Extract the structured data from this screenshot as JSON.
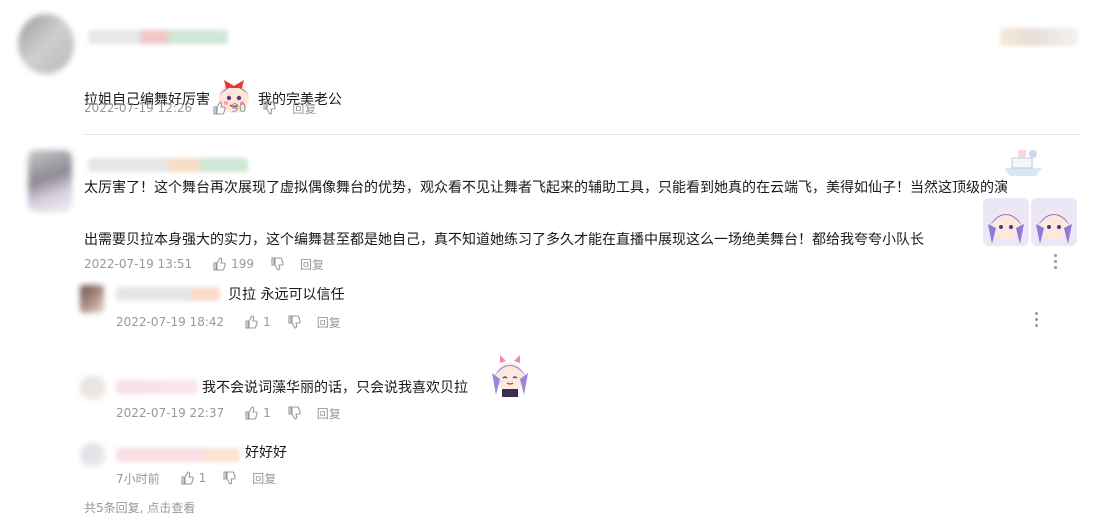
{
  "comments": [
    {
      "text_a": "拉姐自己编舞好厉害",
      "text_b": "我的完美老公",
      "time": "2022-07-19 12:26",
      "likes": "90",
      "reply_label": "回复"
    },
    {
      "line1": "太厉害了！这个舞台再次展现了虚拟偶像舞台的优势，观众看不见让舞者飞起来的辅助工具，只能看到她真的在云端飞，美得如仙子！当然这顶级的演",
      "line2": "出需要贝拉本身强大的实力，这个编舞甚至都是她自己，真不知道她练习了多久才能在直播中展现这么一场绝美舞台！都给我夸夸小队长",
      "time": "2022-07-19 13:51",
      "likes": "199",
      "reply_label": "回复",
      "replies": [
        {
          "text": "贝拉 永远可以信任",
          "time": "2022-07-19 18:42",
          "likes": "1",
          "reply_label": "回复"
        },
        {
          "text": "我不会说词藻华丽的话，只会说我喜欢贝拉",
          "time": "2022-07-19 22:37",
          "likes": "1",
          "reply_label": "回复"
        },
        {
          "text": "好好好",
          "time": "7小时前",
          "likes": "1",
          "reply_label": "回复"
        }
      ],
      "footer": "共5条回复, 点击查看"
    }
  ]
}
